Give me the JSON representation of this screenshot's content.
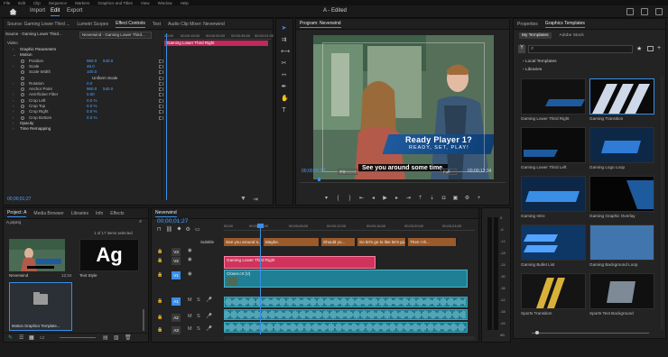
{
  "menu": [
    "File",
    "Edit",
    "Clip",
    "Sequence",
    "Markers",
    "Graphics and Titles",
    "View",
    "Window",
    "Help"
  ],
  "workspace": {
    "tabs": [
      "Import",
      "Edit",
      "Export"
    ],
    "active": "Edit",
    "title": "A - Edited"
  },
  "source_panel": {
    "tabs": [
      "Source: Gaming Lower Third ...",
      "Lumetri Scopes",
      "Effect Controls",
      "Text",
      "Audio Clip Mixer: Neverwind"
    ],
    "master": "Source · Gaming Lower Third...",
    "sequence": "Neverwind - Gaming Lower Third...",
    "clip_bar_label": "Gaming Lower Third Right",
    "ruler": [
      "00:00",
      "00:00:15:00",
      "00:00:30:00",
      "00:00:45:00",
      "00:00:01:00"
    ],
    "section": "Video",
    "rows": [
      {
        "arrow": "›",
        "label": "Graphic Parameters",
        "v1": "",
        "v2": "",
        "header": true
      },
      {
        "arrow": "⌄",
        "label": "Motion",
        "v1": "",
        "v2": "",
        "header": true
      },
      {
        "arrow": "",
        "label": "Position",
        "v1": "960.0",
        "v2": "540.0"
      },
      {
        "arrow": "›",
        "label": "Scale",
        "v1": "46.0",
        "v2": ""
      },
      {
        "arrow": "",
        "label": "Scale Width",
        "v1": "100.0",
        "v2": ""
      },
      {
        "arrow": "",
        "label": "",
        "v1": "",
        "v2": "Uniform Scale"
      },
      {
        "arrow": "›",
        "label": "Rotation",
        "v1": "0.0",
        "v2": ""
      },
      {
        "arrow": "",
        "label": "Anchor Point",
        "v1": "960.0",
        "v2": "540.0"
      },
      {
        "arrow": "›",
        "label": "Anti-flicker Filter",
        "v1": "0.00",
        "v2": ""
      },
      {
        "arrow": "›",
        "label": "Crop Left",
        "v1": "0.0 %",
        "v2": ""
      },
      {
        "arrow": "›",
        "label": "Crop Top",
        "v1": "0.0 %",
        "v2": ""
      },
      {
        "arrow": "›",
        "label": "Crop Right",
        "v1": "0.0 %",
        "v2": ""
      },
      {
        "arrow": "›",
        "label": "Crop Bottom",
        "v1": "0.0 %",
        "v2": ""
      },
      {
        "arrow": "›",
        "label": "Opacity",
        "v1": "",
        "v2": "",
        "header": true
      },
      {
        "arrow": "›",
        "label": "Time Remapping",
        "v1": "",
        "v2": "",
        "header": true
      }
    ],
    "timecode": "00;00;01;27"
  },
  "program": {
    "title": "Program: Neverwind",
    "timecode": "00;00;01;27",
    "fit": "Fit",
    "quality": "Full",
    "duration": "00;00;12;34",
    "lower_third_title": "Ready Player 1?",
    "lower_third_sub": "READY, SET, PLAY!",
    "caption": "See you around some time."
  },
  "templates": {
    "tabs": [
      "Properties",
      "Graphics Templates"
    ],
    "subtabs": [
      "My Templates",
      "Adobe Stock"
    ],
    "search_placeholder": "",
    "folders": [
      "Local Templates",
      "Libraries"
    ],
    "items": [
      "Gaming Lower Third Right",
      "Gaming Transition",
      "Gaming Lower Third Left",
      "Gaming Logo Loop",
      "Gaming Intro",
      "Gaming Graphic Overlay",
      "Gaming Bullet List",
      "Gaming Background Loop",
      "Sports Transition",
      "Sports Text Background"
    ]
  },
  "project": {
    "tabs": [
      "Project: A",
      "Media Browser",
      "Libraries",
      "Info",
      "Effects"
    ],
    "file": "A.prproj",
    "count": "1 of 17 items selected",
    "items": [
      {
        "name": "Neverwind",
        "meta": "12;34"
      },
      {
        "name": "Text Style",
        "glyph": "Ag"
      },
      {
        "name": "Motion Graphics Template...",
        "folder": true
      }
    ]
  },
  "timeline": {
    "tab": "Neverwind",
    "timecode": "00;00;01;27",
    "ruler": [
      "00;00",
      "00;00;04;00",
      "00;00;08;00",
      "00;00;12;00",
      "00;00;16;00",
      "00;00;20;00",
      "00;00;24;00"
    ],
    "subtitle_label": "Subtitle",
    "captions": [
      "See you around s...",
      "Maybe.",
      "Should yo...",
      "So let's go to like let's go...",
      "Then I th..."
    ],
    "tracks": [
      "V3",
      "V2",
      "V1",
      "A1",
      "A2",
      "A3"
    ],
    "graphic_clip": "Gaming Lower Third Right",
    "video_clip": "Closer.crt [V]",
    "meter": [
      "0",
      "-6",
      "-12",
      "-18",
      "-24",
      "-30",
      "-36",
      "-42",
      "-48",
      "-54"
    ],
    "meter_unit": "dB"
  },
  "colors": {
    "accent": "#3a8ee6",
    "caption_clip": "#9b5a2a",
    "graphic_clip": "#d0335b",
    "video_clip": "#1f7f95",
    "audio_clip": "#1c7a8f"
  }
}
